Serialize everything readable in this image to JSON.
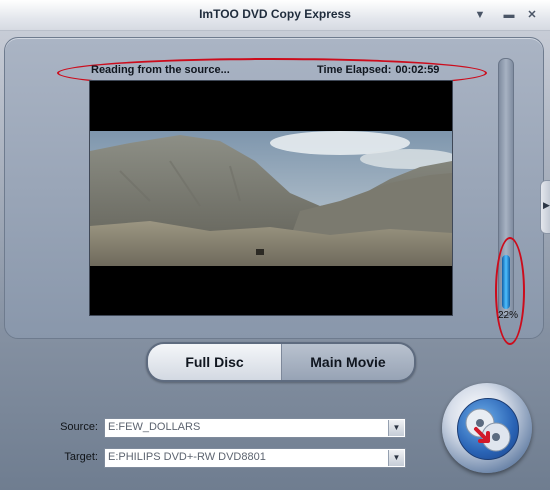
{
  "window": {
    "title": "ImTOO DVD Copy Express"
  },
  "titlebar_buttons": {
    "menu_icon": "▼",
    "minimize_icon": "▬",
    "close_icon": "✕"
  },
  "status": {
    "text": "Reading from the source...",
    "time_label": "Time Elapsed:",
    "time_value": "00:02:59"
  },
  "progress": {
    "percent": 22,
    "label": "22%"
  },
  "mode": {
    "full_disc_label": "Full Disc",
    "main_movie_label": "Main Movie"
  },
  "source": {
    "label": "Source:",
    "value": "E:FEW_DOLLARS"
  },
  "target": {
    "label": "Target:",
    "value": "E:PHILIPS DVD+-RW DVD8801"
  },
  "icons": {
    "dropdown": "▼",
    "side_expand": "▶",
    "copy": "disc-copy-icon"
  },
  "colors": {
    "highlight_oval": "#cc0c1c",
    "progress_fill": "#2a9be8"
  }
}
